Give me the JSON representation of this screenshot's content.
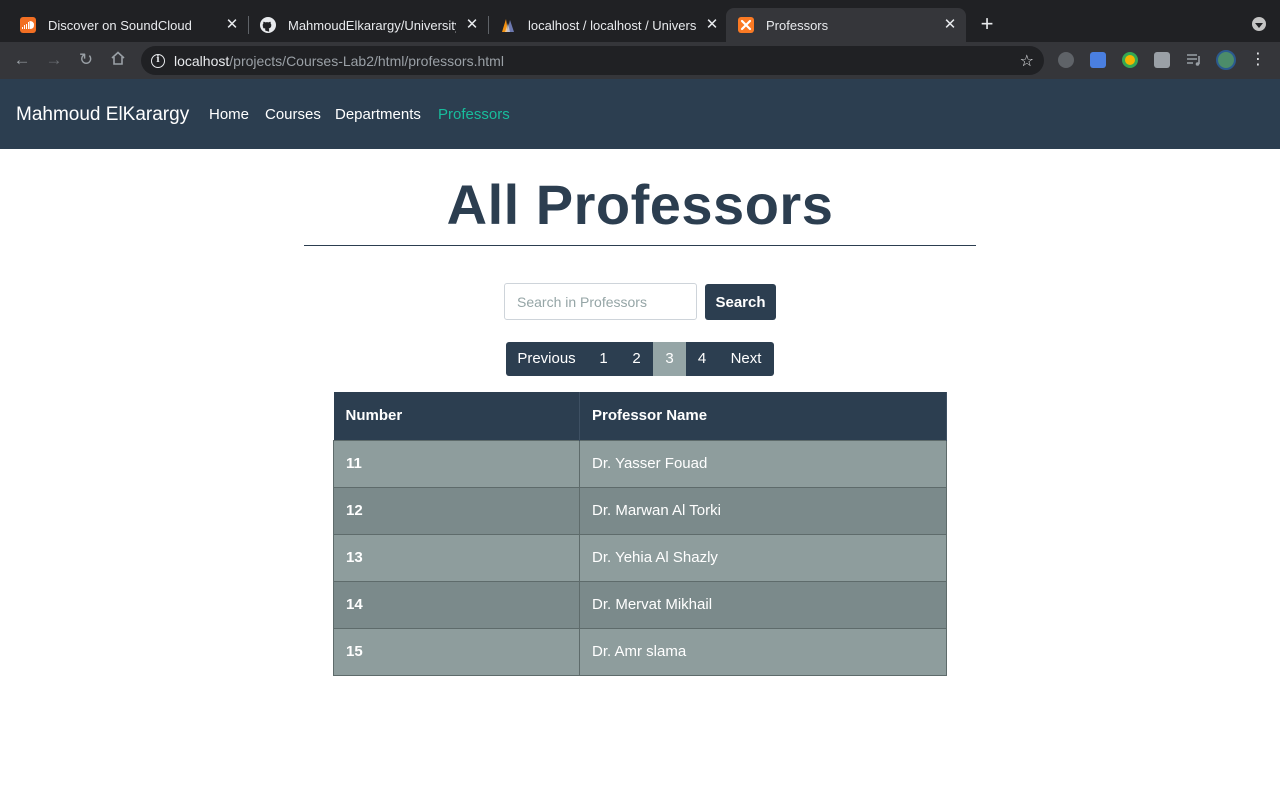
{
  "browser": {
    "tabs": [
      {
        "title": "Discover on SoundCloud",
        "icon": "soundcloud-icon",
        "color": "#f26f23"
      },
      {
        "title": "MahmoudElkarargy/University-",
        "icon": "github-icon",
        "color": "#e8eaed"
      },
      {
        "title": "localhost / localhost / Universit",
        "icon": "phpmyadmin-icon",
        "color": "#f29111"
      },
      {
        "title": "Professors",
        "icon": "xampp-icon",
        "color": "#fb7a24"
      }
    ],
    "active_tab": 3,
    "url_host": "localhost",
    "url_path": "/projects/Courses-Lab2/html/professors.html"
  },
  "navbar": {
    "brand": "Mahmoud ElKarargy",
    "links": [
      "Home",
      "Courses",
      "Departments",
      "Professors"
    ],
    "active_link": "Professors",
    "active_color": "#18bc9c",
    "background": "#2c3e50"
  },
  "main": {
    "title": "All Professors",
    "search": {
      "placeholder": "Search in Professors",
      "value": "",
      "button_label": "Search"
    },
    "pagination": {
      "previous_label": "Previous",
      "pages": [
        "1",
        "2",
        "3",
        "4"
      ],
      "current_page": "3",
      "next_label": "Next"
    },
    "table": {
      "columns": [
        "Number",
        "Professor Name"
      ],
      "rows": [
        {
          "number": "11",
          "name": "Dr. Yasser Fouad"
        },
        {
          "number": "12",
          "name": "Dr. Marwan Al Torki"
        },
        {
          "number": "13",
          "name": "Dr. Yehia Al Shazly"
        },
        {
          "number": "14",
          "name": "Dr. Mervat Mikhail"
        },
        {
          "number": "15",
          "name": "Dr. Amr slama"
        }
      ]
    }
  }
}
